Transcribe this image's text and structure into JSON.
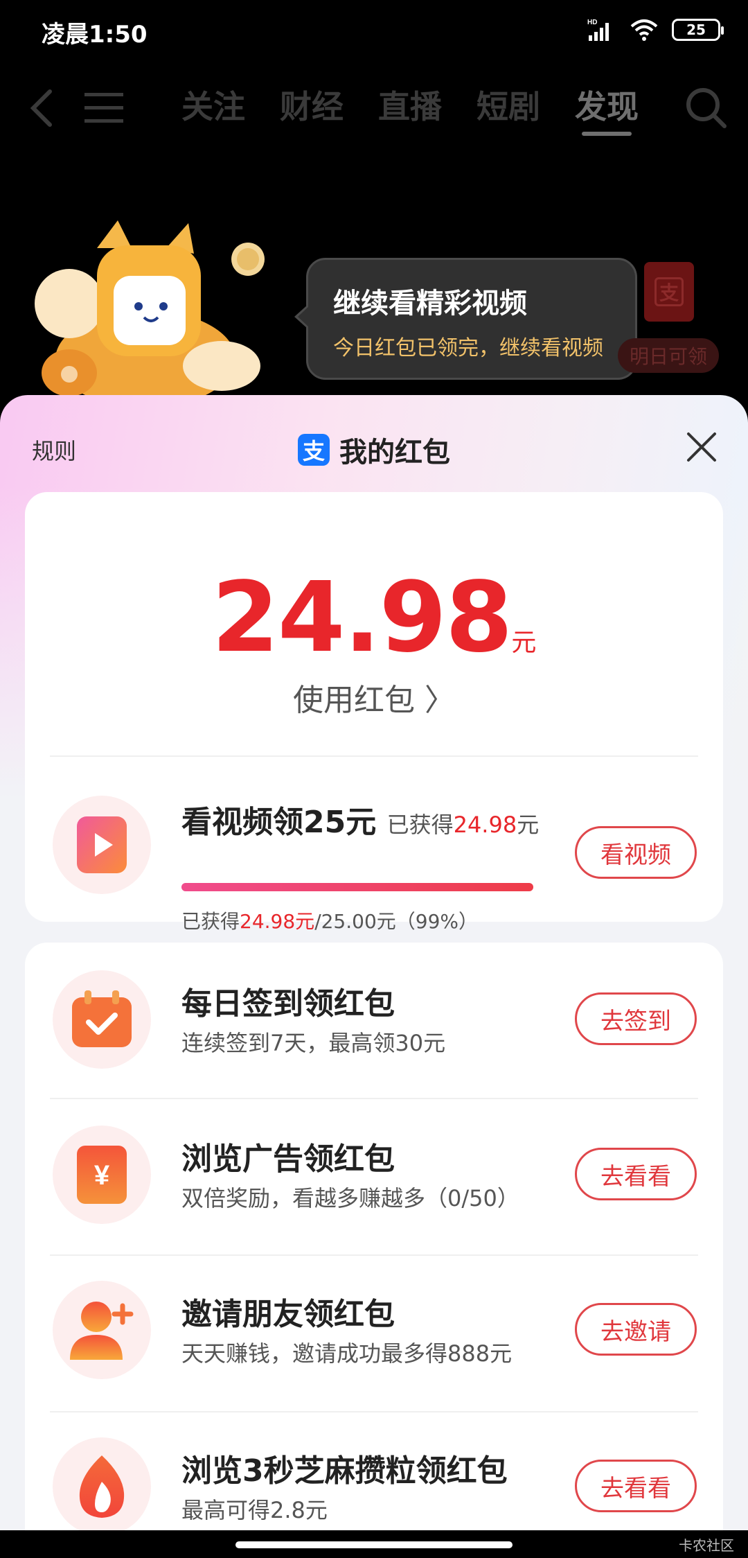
{
  "status_bar": {
    "time": "凌晨1:50",
    "battery": "25"
  },
  "top_nav": {
    "tabs": [
      "关注",
      "财经",
      "直播",
      "短剧",
      "发现"
    ],
    "active_tab": "发现"
  },
  "tooltip": {
    "title": "继续看精彩视频",
    "subtitle": "今日红包已领完，继续看视频"
  },
  "envelope": {
    "logo": "支",
    "tomorrow_label": "明日可领"
  },
  "sheet": {
    "rules_label": "规则",
    "logo": "支",
    "title": "我的红包",
    "amount": "24.98",
    "amount_unit": "元",
    "use_link": "使用红包 〉"
  },
  "video_task": {
    "title": "看视频领25元",
    "earned_prefix": "已获得",
    "earned_value": "24.98",
    "earned_unit": "元",
    "progress_prefix": "已获得",
    "progress_value": "24.98元",
    "progress_rest": "/25.00元（99%）",
    "progress": 0.9992,
    "button": "看视频"
  },
  "tasks": [
    {
      "title": "每日签到领红包",
      "subtitle": "连续签到7天，最高领30元",
      "button": "去签到",
      "icon": "calendar-check-icon"
    },
    {
      "title": "浏览广告领红包",
      "subtitle": "双倍奖励，看越多赚越多（0/50）",
      "button": "去看看",
      "icon": "yuan-coupon-icon"
    },
    {
      "title": "邀请朋友领红包",
      "subtitle": "天天赚钱，邀请成功最多得888元",
      "button": "去邀请",
      "icon": "add-friend-icon"
    },
    {
      "title": "浏览3秒芝麻攒粒领红包",
      "subtitle": "最高可得2.8元",
      "button": "去看看",
      "icon": "flame-icon"
    }
  ],
  "watermark": "卡农社区",
  "colors": {
    "accent": "#e8262b",
    "alipay": "#1677ff"
  }
}
